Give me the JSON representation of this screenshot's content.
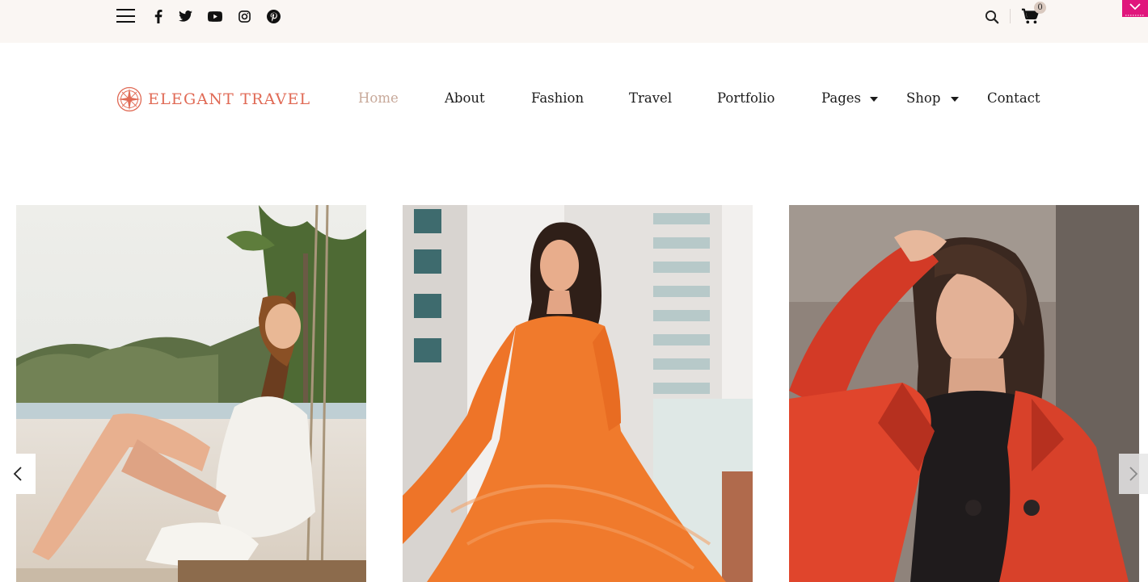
{
  "topbar": {
    "menu_icon": "hamburger-menu-icon",
    "social": [
      {
        "name": "facebook-icon"
      },
      {
        "name": "twitter-icon"
      },
      {
        "name": "youtube-icon"
      },
      {
        "name": "instagram-icon"
      },
      {
        "name": "pinterest-icon"
      }
    ],
    "search_icon": "search-icon",
    "cart_icon": "shopping-cart-icon",
    "cart_count": "0",
    "corner_toggle_icon": "chevron-down-icon",
    "corner_color": "#e0167c",
    "background": "#faf6f3"
  },
  "header": {
    "logo_text": "ELEGANT TRAVEL",
    "logo_color": "#e06a55",
    "nav": [
      {
        "label": "Home",
        "active": true
      },
      {
        "label": "About"
      },
      {
        "label": "Fashion"
      },
      {
        "label": "Travel"
      },
      {
        "label": "Portfolio"
      },
      {
        "label": "Pages",
        "dropdown": true
      },
      {
        "label": "Shop",
        "dropdown": true
      },
      {
        "label": "Contact"
      }
    ],
    "active_color": "#c7a899"
  },
  "gallery": {
    "slides": [
      {
        "name": "slide-beach-swing-photo"
      },
      {
        "name": "slide-orange-dress-photo"
      },
      {
        "name": "slide-red-coat-photo"
      }
    ],
    "prev_icon": "chevron-left-icon",
    "next_icon": "chevron-right-icon"
  }
}
